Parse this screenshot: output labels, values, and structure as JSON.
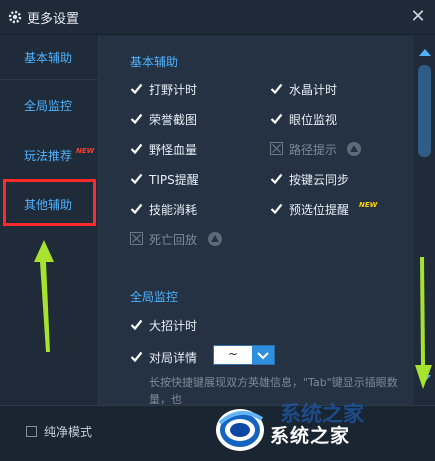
{
  "window": {
    "title": "更多设置",
    "close_glyph": "✕"
  },
  "sidebar": {
    "items": [
      {
        "label": "基本辅助"
      },
      {
        "label": "全局监控"
      },
      {
        "label": "玩法推荐",
        "badge": "NEW"
      },
      {
        "label": "其他辅助"
      }
    ]
  },
  "sections": {
    "basic": {
      "title": "基本辅助",
      "options": [
        {
          "label": "打野计时",
          "checked": true
        },
        {
          "label": "水晶计时",
          "checked": true
        },
        {
          "label": "荣誉截图",
          "checked": true
        },
        {
          "label": "眼位监视",
          "checked": true
        },
        {
          "label": "野怪血量",
          "checked": true
        },
        {
          "label": "路径提示",
          "checked": false,
          "disabled": true
        },
        {
          "label": "TIPS提醒",
          "checked": true
        },
        {
          "label": "按键云同步",
          "checked": true
        },
        {
          "label": "技能消耗",
          "checked": true
        },
        {
          "label": "预选位提醒",
          "checked": true,
          "badge": "NEW"
        },
        {
          "label": "死亡回放",
          "checked": false,
          "disabled": true
        }
      ]
    },
    "global": {
      "title": "全局监控",
      "options": [
        {
          "label": "大招计时",
          "checked": true
        },
        {
          "label": "对局详情",
          "checked": true
        }
      ],
      "detail_select": {
        "value": "~"
      },
      "hint": "长按快捷键展现双方英雄信息，\"Tab\"键显示插眼数量，也"
    }
  },
  "footer": {
    "pure_mode_label": "纯净模式",
    "pure_mode_checked": false
  },
  "watermark": {
    "text": "系统之家",
    "faded_text": "系统之家"
  },
  "colors": {
    "accent": "#4fb2ff",
    "annotation_red": "#ff2a2a",
    "annotation_arrow": "#a6e22e"
  }
}
